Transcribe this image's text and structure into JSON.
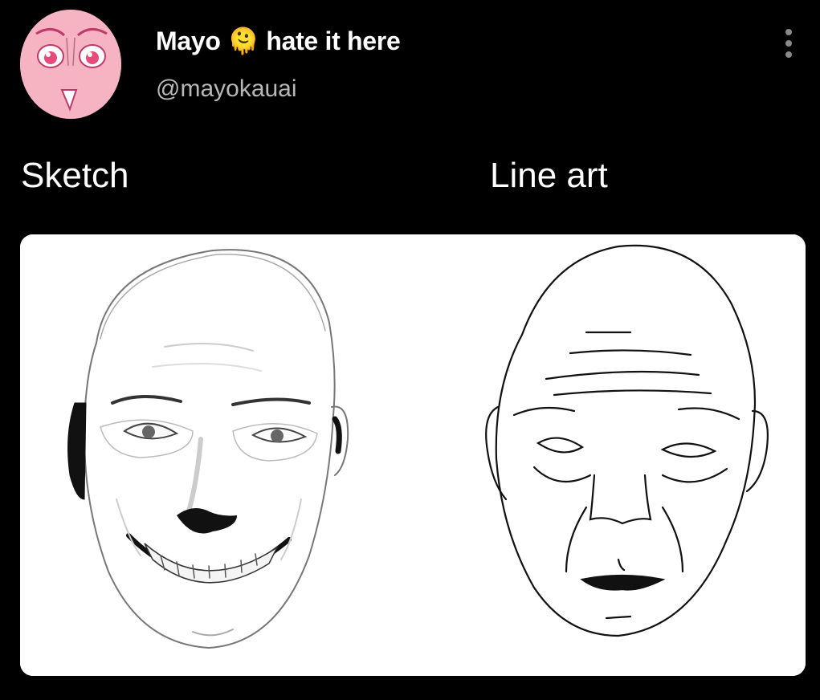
{
  "post": {
    "display_name": "Mayo 🫠 hate it here",
    "handle": "@mayokauai",
    "more_icon": "more-vertical-icon"
  },
  "image": {
    "label_left": "Sketch",
    "label_right": "Line art"
  },
  "colors": {
    "background": "#000000",
    "avatar_bg": "#f6b3c2",
    "handle_text": "#b8b8b8"
  }
}
